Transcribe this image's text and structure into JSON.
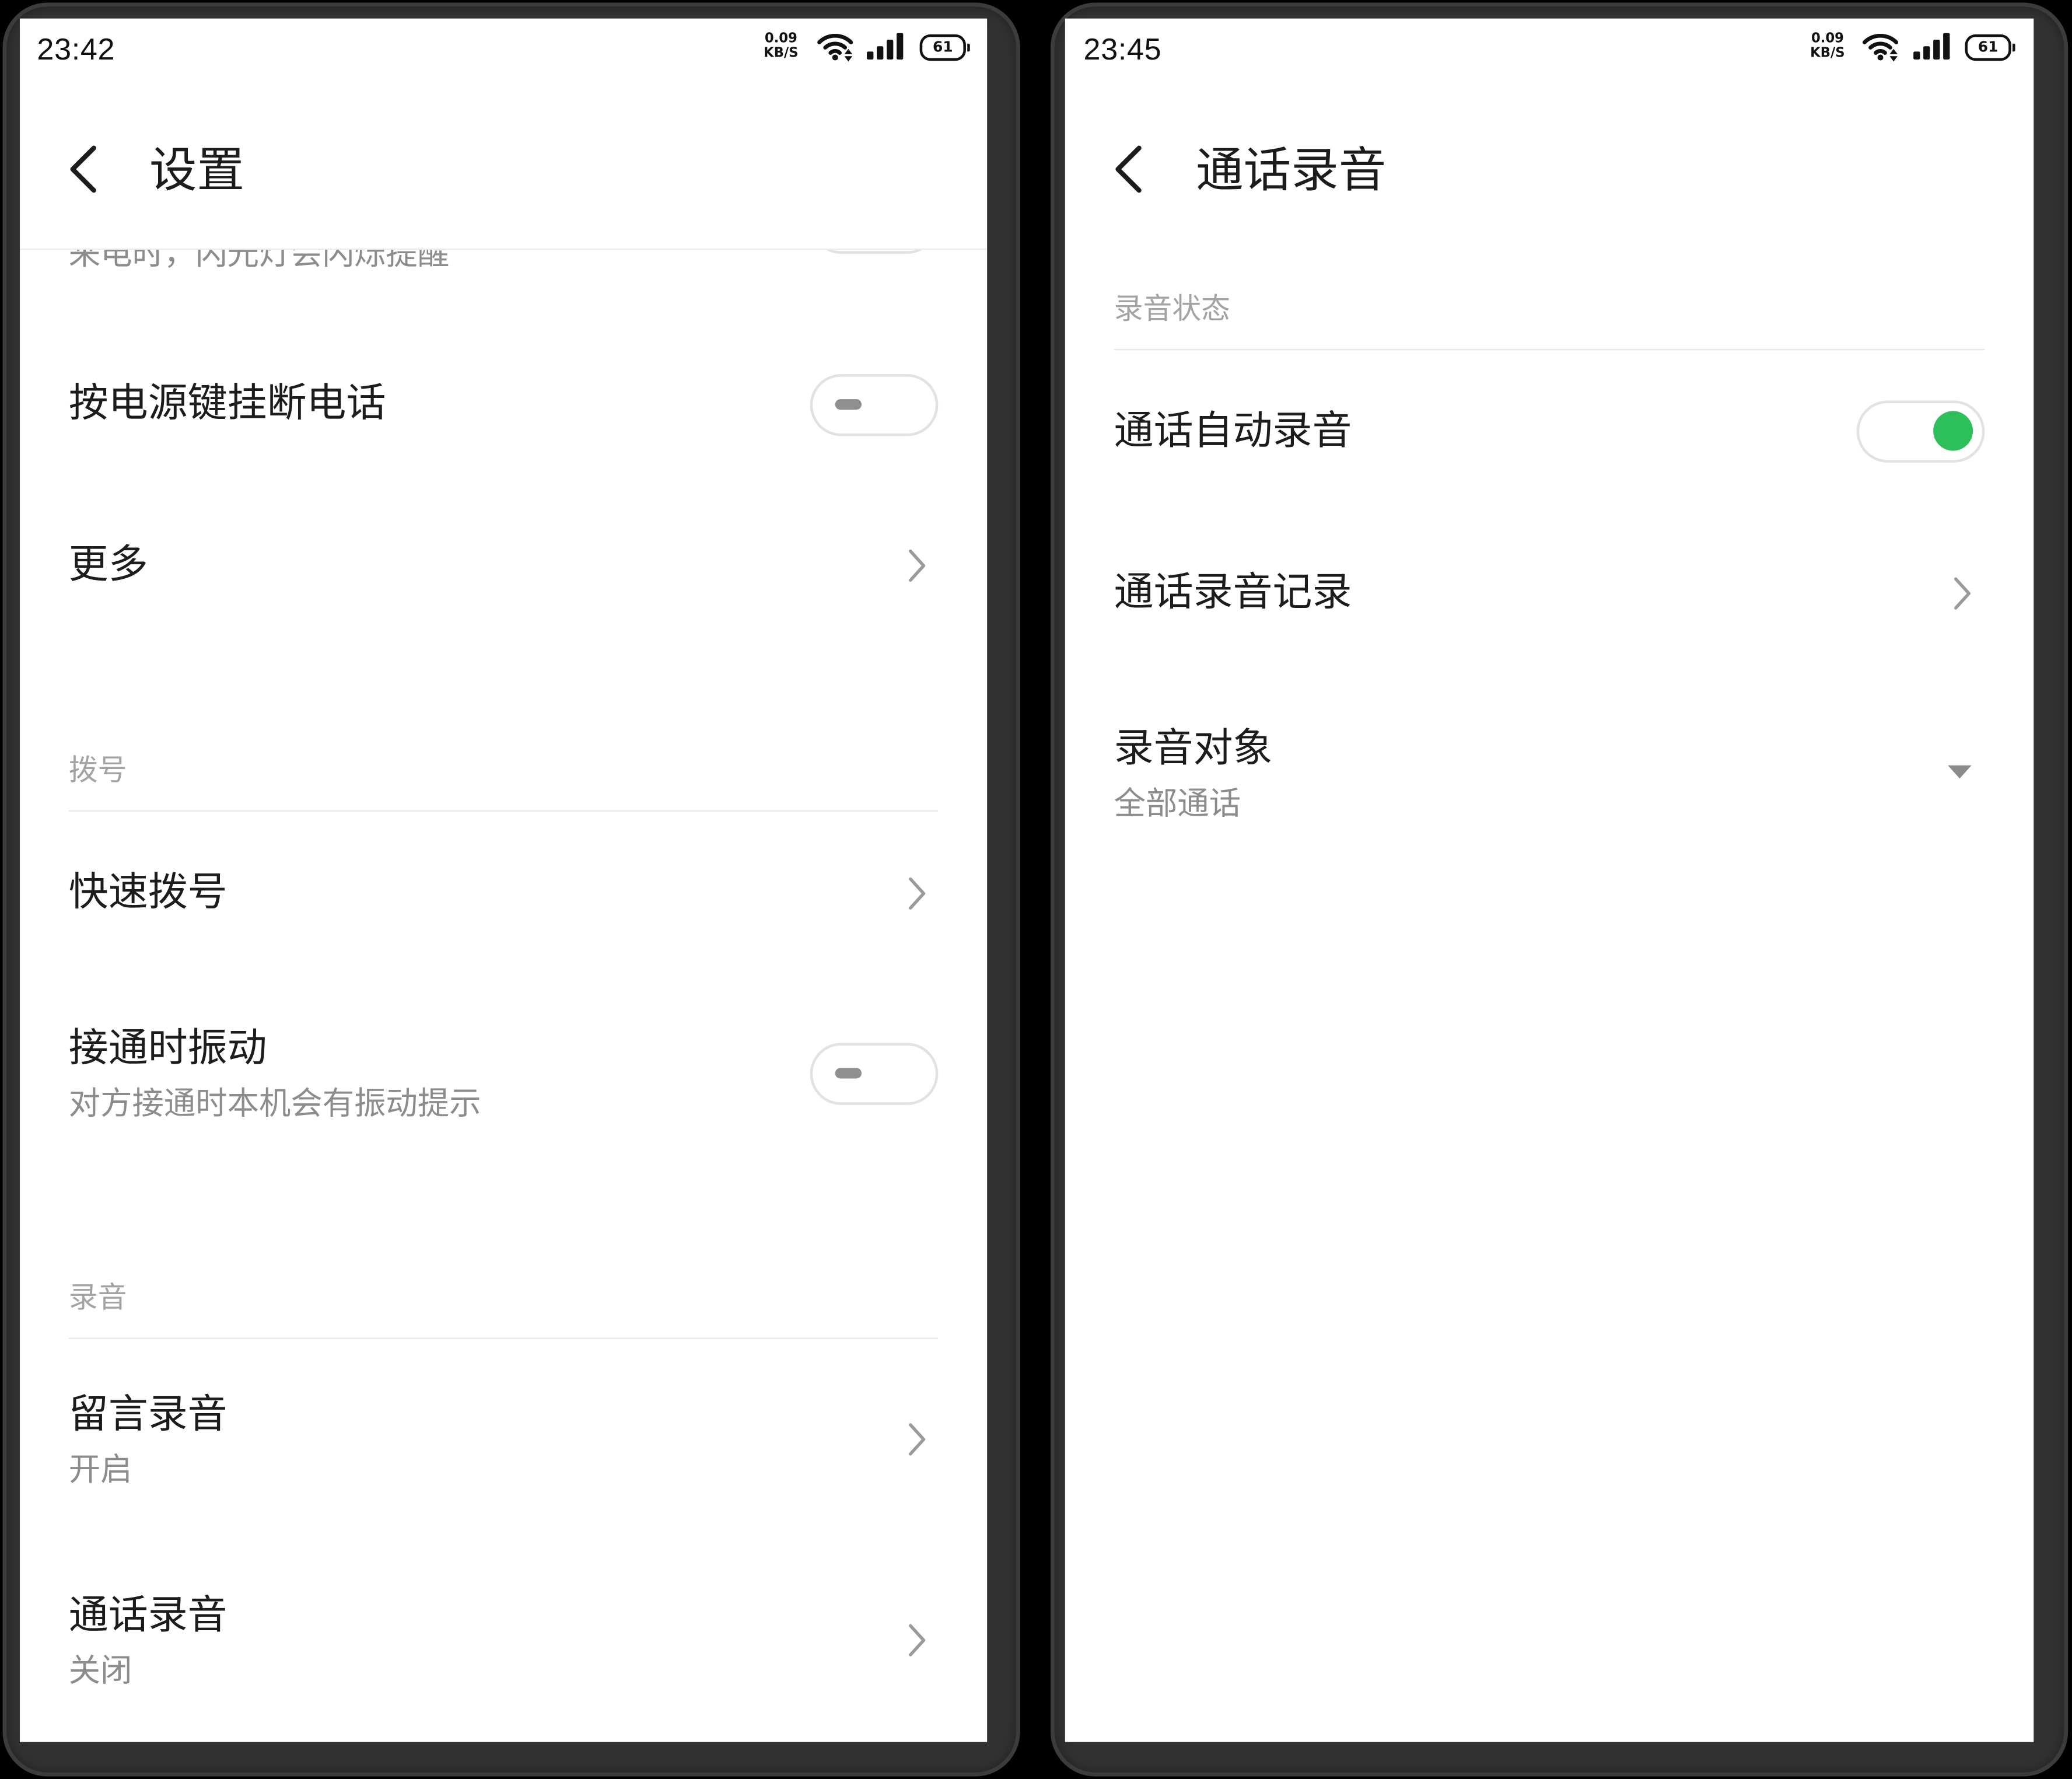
{
  "colors": {
    "background": "#000000",
    "frame": "#323232",
    "screen": "#ffffff",
    "text_primary": "#1c1c1c",
    "text_secondary": "#8c8c8c",
    "section_header": "#a3a3a3",
    "divider": "#e8e8e8",
    "accent_green": "#2dbf5a"
  },
  "icons": {
    "back": "back-arrow-icon",
    "row_link": "chevron-right-icon",
    "row_dropdown": "dropdown-triangle-icon",
    "wifi": "wifi-icon",
    "signal": "cellular-signal-icon",
    "battery": "battery-icon"
  },
  "left_screen": {
    "status_bar": {
      "time": "23:42",
      "net_speed": "0.09",
      "net_unit": "KB/S",
      "battery_level": "61"
    },
    "header": {
      "title": "设置"
    },
    "partial_item": {
      "subtitle": "来电时，闪光灯会闪烁提醒",
      "switch_on": false
    },
    "items": [
      {
        "title": "按电源键挂断电话",
        "switch_on": false
      },
      {
        "title": "更多",
        "trailing_icon": "chevron-right-icon"
      }
    ],
    "sections": [
      {
        "header": "拨号",
        "items": [
          {
            "title": "快速拨号",
            "trailing_icon": "chevron-right-icon"
          },
          {
            "title": "接通时振动",
            "subtitle": "对方接通时本机会有振动提示",
            "switch_on": false
          }
        ]
      },
      {
        "header": "录音",
        "items": [
          {
            "title": "留言录音",
            "subtitle": "开启",
            "trailing_icon": "chevron-right-icon"
          },
          {
            "title": "通话录音",
            "subtitle": "关闭",
            "trailing_icon": "chevron-right-icon"
          }
        ]
      }
    ]
  },
  "right_screen": {
    "status_bar": {
      "time": "23:45",
      "net_speed": "0.09",
      "net_unit": "KB/S",
      "battery_level": "61"
    },
    "header": {
      "title": "通话录音"
    },
    "sections": [
      {
        "header": "录音状态",
        "items": [
          {
            "title": "通话自动录音",
            "switch_on": true
          },
          {
            "title": "通话录音记录",
            "trailing_icon": "chevron-right-icon"
          },
          {
            "title": "录音对象",
            "subtitle": "全部通话",
            "trailing_icon": "dropdown-triangle-icon"
          }
        ]
      }
    ]
  }
}
